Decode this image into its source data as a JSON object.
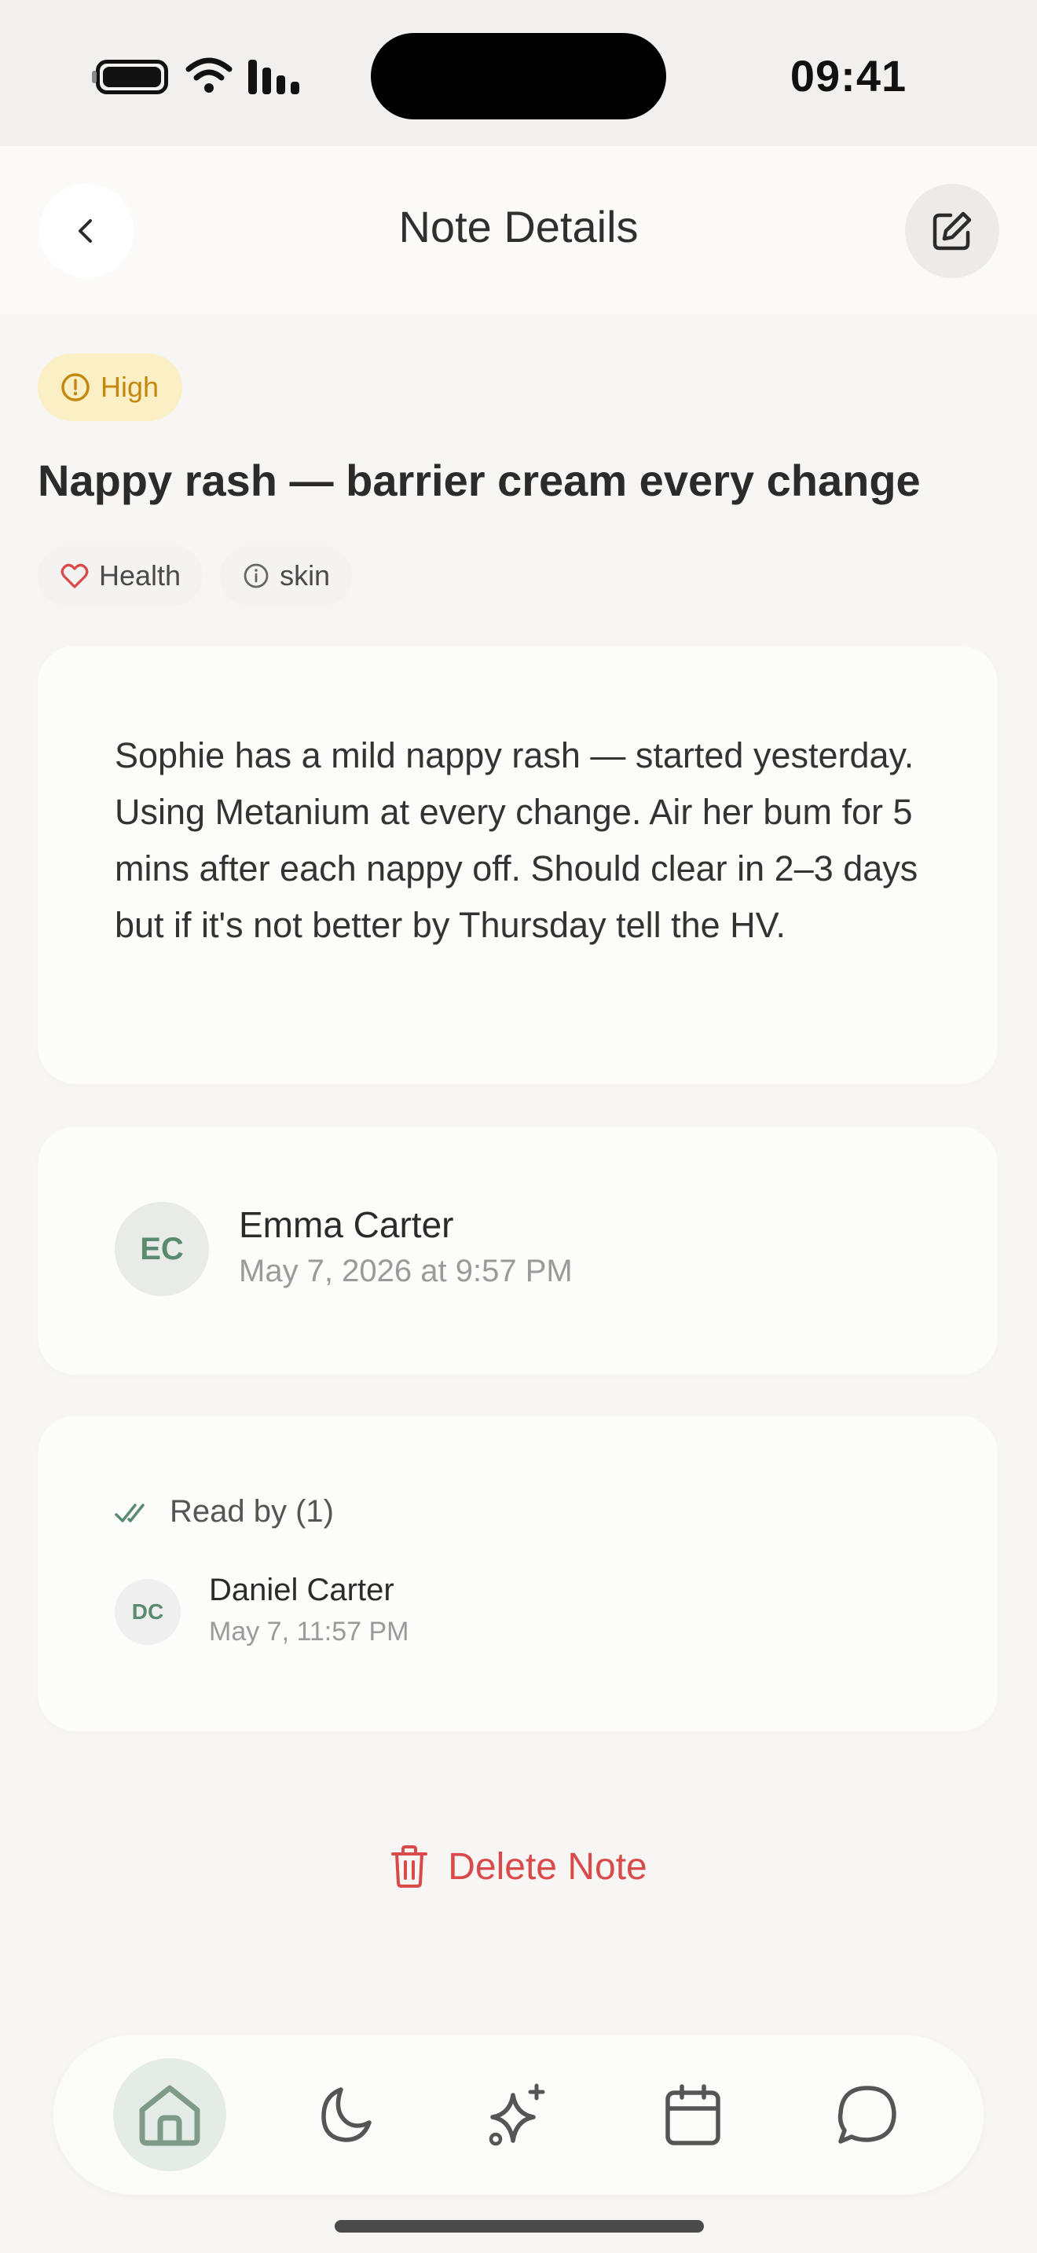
{
  "status_bar": {
    "time": "09:41"
  },
  "header": {
    "title": "Note Details"
  },
  "note": {
    "priority": "High",
    "title": "Nappy rash — barrier cream every change",
    "tags": [
      {
        "label": "Health",
        "icon": "heart-icon"
      },
      {
        "label": "skin",
        "icon": "info-icon"
      }
    ],
    "body": "Sophie has a mild nappy rash — started yesterday. Using Metanium at every change. Air her bum for 5 mins after each nappy off. Should clear in 2–3 days but if it's not better by Thursday tell the HV."
  },
  "author": {
    "initials": "EC",
    "name": "Emma Carter",
    "date": "May 7, 2026 at 9:57 PM"
  },
  "read_by": {
    "label": "Read by (1)",
    "readers": [
      {
        "initials": "DC",
        "name": "Daniel Carter",
        "time": "May 7, 11:57 PM"
      }
    ]
  },
  "actions": {
    "delete_label": "Delete Note"
  },
  "tab_bar": {
    "tabs": [
      {
        "icon": "home-icon",
        "active": true
      },
      {
        "icon": "moon-icon",
        "active": false
      },
      {
        "icon": "sparkles-icon",
        "active": false
      },
      {
        "icon": "calendar-icon",
        "active": false
      },
      {
        "icon": "chat-icon",
        "active": false
      }
    ]
  },
  "colors": {
    "accent": "#5a8a6f",
    "priority_high": "#c4880f",
    "danger": "#d94a4a",
    "tag_heart": "#d94a4a"
  }
}
